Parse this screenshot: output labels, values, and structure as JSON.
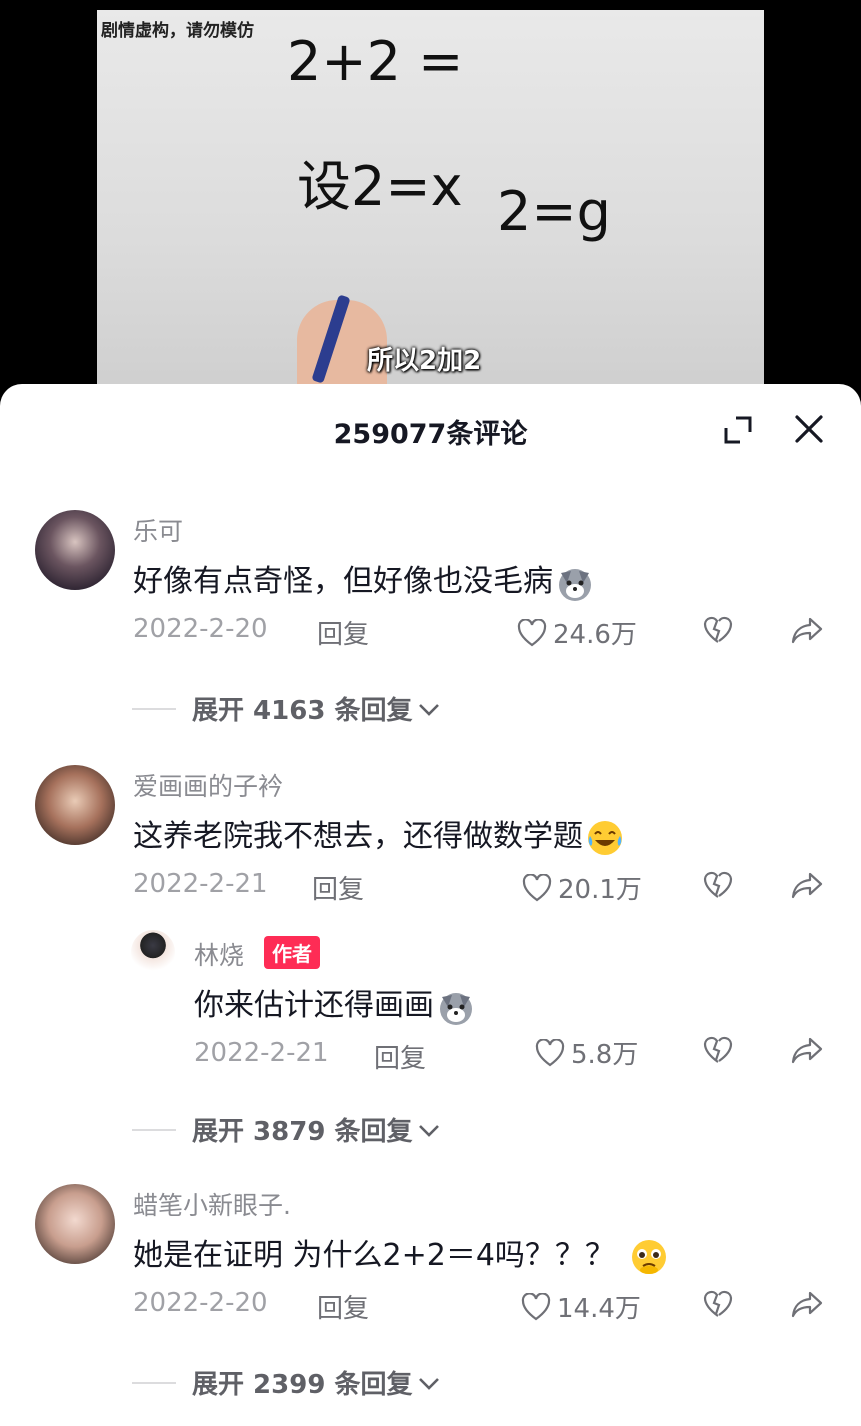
{
  "video": {
    "watermark": "剧情虚构，请勿模仿",
    "subtitle": "所以2加2",
    "board_line1": "2+2 =",
    "board_line2a": "设2=x",
    "board_line2b": "2=g"
  },
  "panel": {
    "comment_count": "259077条评论"
  },
  "comments": [
    {
      "username": "乐可",
      "text": "好像有点奇怪，但好像也没毛病",
      "emoji": "wolf-emoji",
      "date": "2022-2-20",
      "reply_label": "回复",
      "likes": "24.6万",
      "expand": "展开 4163 条回复"
    },
    {
      "username": "爱画画的子衿",
      "text": "这养老院我不想去，还得做数学题",
      "emoji": "laugh-cry-emoji",
      "date": "2022-2-21",
      "reply_label": "回复",
      "likes": "20.1万",
      "reply": {
        "username": "林烧",
        "badge": "作者",
        "text": "你来估计还得画画",
        "emoji": "wolf-emoji",
        "date": "2022-2-21",
        "reply_label": "回复",
        "likes": "5.8万"
      },
      "expand": "展开 3879 条回复"
    },
    {
      "username": "蜡笔小新眼子.",
      "text": "她是在证明 为什么2+2＝4吗？？？",
      "emoji": "pleading-emoji",
      "date": "2022-2-20",
      "reply_label": "回复",
      "likes": "14.4万",
      "expand": "展开 2399 条回复"
    }
  ],
  "colors": {
    "accent": "#fe2c55",
    "text_primary": "#161823",
    "text_secondary": "#8a8b91"
  }
}
